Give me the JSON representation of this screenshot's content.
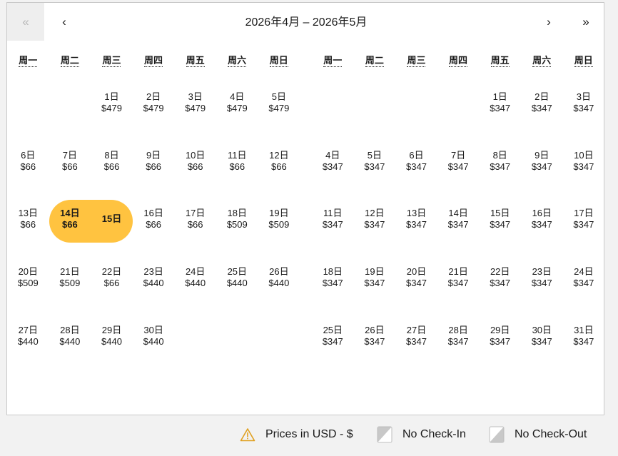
{
  "header": {
    "prev_year": "«",
    "prev_month": "‹",
    "title": "2026年4月 – 2026年5月",
    "next_month": "›",
    "next_year": "»"
  },
  "weekdays": [
    "周一",
    "周二",
    "周三",
    "周四",
    "周五",
    "周六",
    "周日"
  ],
  "months": [
    {
      "first_weekday_index": 2,
      "days": [
        {
          "d": "1日",
          "p": "$479"
        },
        {
          "d": "2日",
          "p": "$479"
        },
        {
          "d": "3日",
          "p": "$479"
        },
        {
          "d": "4日",
          "p": "$479"
        },
        {
          "d": "5日",
          "p": "$479"
        },
        {
          "d": "6日",
          "p": "$66"
        },
        {
          "d": "7日",
          "p": "$66"
        },
        {
          "d": "8日",
          "p": "$66"
        },
        {
          "d": "9日",
          "p": "$66"
        },
        {
          "d": "10日",
          "p": "$66"
        },
        {
          "d": "11日",
          "p": "$66"
        },
        {
          "d": "12日",
          "p": "$66"
        },
        {
          "d": "13日",
          "p": "$66"
        },
        {
          "d": "14日",
          "p": "$66",
          "selected": true
        },
        {
          "d": "15日",
          "p": "",
          "selected": true
        },
        {
          "d": "16日",
          "p": "$66"
        },
        {
          "d": "17日",
          "p": "$66"
        },
        {
          "d": "18日",
          "p": "$509"
        },
        {
          "d": "19日",
          "p": "$509"
        },
        {
          "d": "20日",
          "p": "$509"
        },
        {
          "d": "21日",
          "p": "$509"
        },
        {
          "d": "22日",
          "p": "$66"
        },
        {
          "d": "23日",
          "p": "$440"
        },
        {
          "d": "24日",
          "p": "$440"
        },
        {
          "d": "25日",
          "p": "$440"
        },
        {
          "d": "26日",
          "p": "$440"
        },
        {
          "d": "27日",
          "p": "$440"
        },
        {
          "d": "28日",
          "p": "$440"
        },
        {
          "d": "29日",
          "p": "$440"
        },
        {
          "d": "30日",
          "p": "$440"
        }
      ]
    },
    {
      "first_weekday_index": 4,
      "days": [
        {
          "d": "1日",
          "p": "$347"
        },
        {
          "d": "2日",
          "p": "$347"
        },
        {
          "d": "3日",
          "p": "$347"
        },
        {
          "d": "4日",
          "p": "$347"
        },
        {
          "d": "5日",
          "p": "$347"
        },
        {
          "d": "6日",
          "p": "$347"
        },
        {
          "d": "7日",
          "p": "$347"
        },
        {
          "d": "8日",
          "p": "$347"
        },
        {
          "d": "9日",
          "p": "$347"
        },
        {
          "d": "10日",
          "p": "$347"
        },
        {
          "d": "11日",
          "p": "$347"
        },
        {
          "d": "12日",
          "p": "$347"
        },
        {
          "d": "13日",
          "p": "$347"
        },
        {
          "d": "14日",
          "p": "$347"
        },
        {
          "d": "15日",
          "p": "$347"
        },
        {
          "d": "16日",
          "p": "$347"
        },
        {
          "d": "17日",
          "p": "$347"
        },
        {
          "d": "18日",
          "p": "$347"
        },
        {
          "d": "19日",
          "p": "$347"
        },
        {
          "d": "20日",
          "p": "$347"
        },
        {
          "d": "21日",
          "p": "$347"
        },
        {
          "d": "22日",
          "p": "$347"
        },
        {
          "d": "23日",
          "p": "$347"
        },
        {
          "d": "24日",
          "p": "$347"
        },
        {
          "d": "25日",
          "p": "$347"
        },
        {
          "d": "26日",
          "p": "$347"
        },
        {
          "d": "27日",
          "p": "$347"
        },
        {
          "d": "28日",
          "p": "$347"
        },
        {
          "d": "29日",
          "p": "$347"
        },
        {
          "d": "30日",
          "p": "$347"
        },
        {
          "d": "31日",
          "p": "$347"
        }
      ]
    }
  ],
  "legend": {
    "prices": "Prices in USD - $",
    "no_check_in": "No Check-In",
    "no_check_out": "No Check-Out"
  },
  "colors": {
    "selection": "#ffc340",
    "warning_icon": "#e0a020"
  }
}
